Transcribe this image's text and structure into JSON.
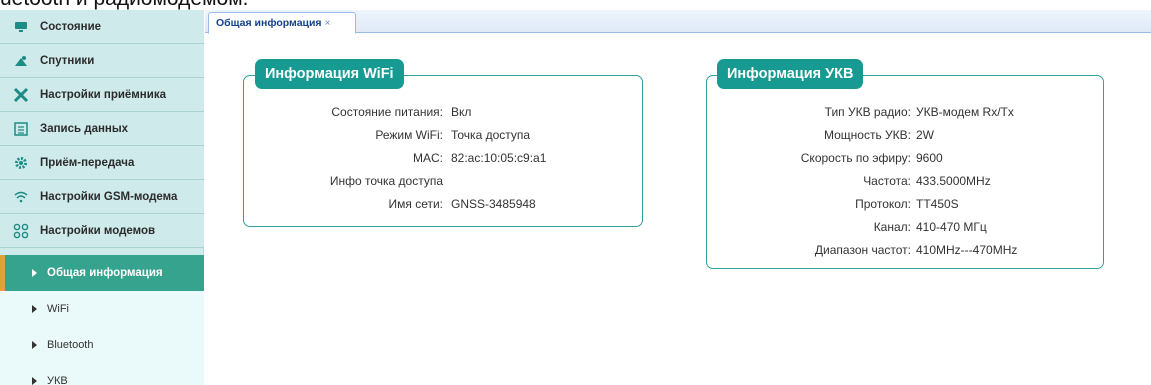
{
  "top_text": "uetooth и радиомодемом.",
  "sidebar": {
    "items": [
      {
        "label": "Состояние",
        "icon": "monitor-icon"
      },
      {
        "label": "Спутники",
        "icon": "satellite-icon"
      },
      {
        "label": "Настройки приёмника",
        "icon": "tools-icon"
      },
      {
        "label": "Запись данных",
        "icon": "list-icon"
      },
      {
        "label": "Приём-передача",
        "icon": "gear-icon"
      },
      {
        "label": "Настройки GSM-модема",
        "icon": "wifi-icon"
      },
      {
        "label": "Настройки модемов",
        "icon": "nodes-icon"
      }
    ],
    "subitems": [
      {
        "label": "Общая информация",
        "active": true
      },
      {
        "label": "WiFi",
        "active": false
      },
      {
        "label": "Bluetooth",
        "active": false
      },
      {
        "label": "УКВ",
        "active": false
      }
    ]
  },
  "tab": {
    "label": "Общая информация",
    "close": "×"
  },
  "wifi_panel": {
    "title": "Информация WiFi",
    "rows": [
      {
        "key": "Состояние питания:",
        "value": "Вкл"
      },
      {
        "key": "Режим WiFi:",
        "value": "Точка доступа"
      },
      {
        "key": "MAC:",
        "value": "82:ac:10:05:c9:a1"
      },
      {
        "key": "Инфо точка доступа",
        "value": ""
      },
      {
        "key": "Имя сети:",
        "value": "GNSS-3485948"
      }
    ]
  },
  "ukv_panel": {
    "title": "Информация УКВ",
    "rows": [
      {
        "key": "Тип УКВ радио:",
        "value": "УКВ-модем Rx/Tx"
      },
      {
        "key": "Мощность УКВ:",
        "value": "2W"
      },
      {
        "key": "Скорость по эфиру:",
        "value": "9600"
      },
      {
        "key": "Частота:",
        "value": "433.5000MHz"
      },
      {
        "key": "Протокол:",
        "value": "TT450S"
      },
      {
        "key": "Канал:",
        "value": "410-470 МГц"
      },
      {
        "key": "Диапазон частот:",
        "value": "410MHz---470MHz"
      }
    ]
  },
  "colors": {
    "accent": "#169a92",
    "active_item": "#36a38e",
    "sidebar_bg": "#cfeaea",
    "active_marker": "#e0a23a"
  }
}
